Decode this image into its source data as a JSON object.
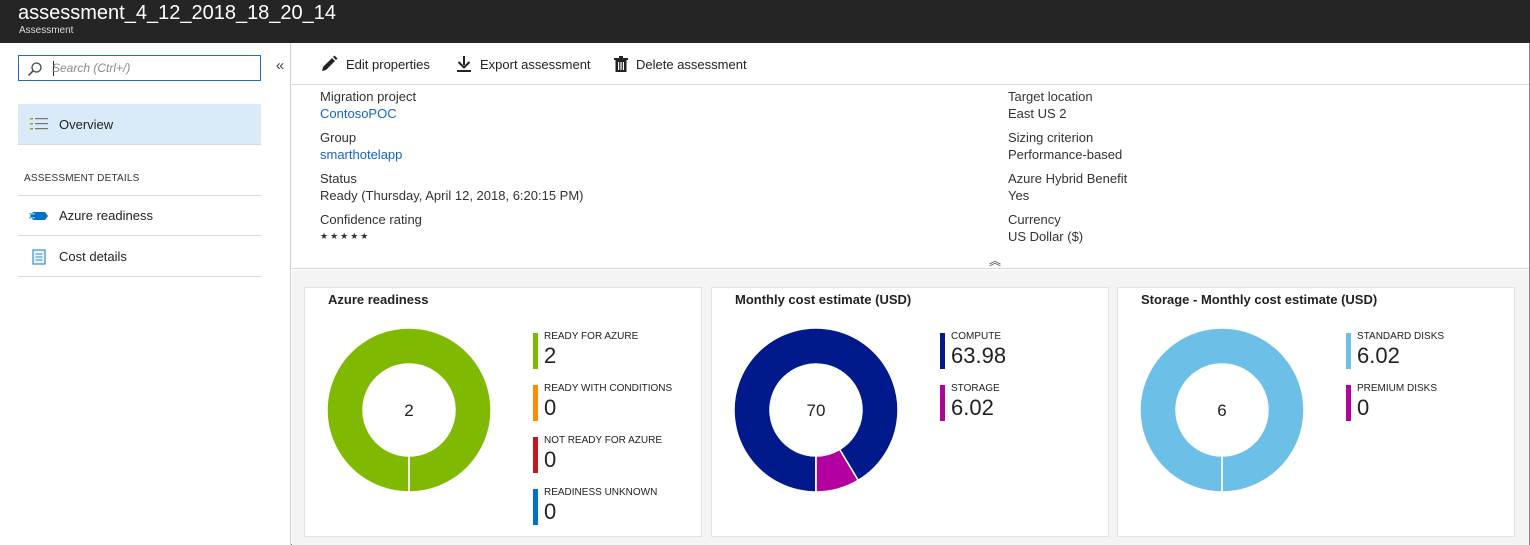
{
  "window": {
    "title": "assessment_4_12_2018_18_20_14",
    "subtitle": "Assessment"
  },
  "sidebar": {
    "search_placeholder": "Search (Ctrl+/)",
    "collapse_icon": "double-chevron-left-icon",
    "overview_label": "Overview",
    "section_header": "ASSESSMENT DETAILS",
    "items": [
      {
        "label": "Azure readiness",
        "icon": "readiness-icon"
      },
      {
        "label": "Cost details",
        "icon": "document-icon"
      }
    ]
  },
  "toolbar": {
    "edit_label": "Edit properties",
    "export_label": "Export assessment",
    "delete_label": "Delete assessment"
  },
  "details": {
    "left": [
      {
        "label": "Migration project",
        "value": "ContosoPOC",
        "link": true
      },
      {
        "label": "Group",
        "value": "smarthotelapp",
        "link": true
      },
      {
        "label": "Status",
        "value": "Ready (Thursday, April 12, 2018, 6:20:15 PM)",
        "link": false
      },
      {
        "label": "Confidence rating",
        "value": "★★★★★",
        "link": false
      }
    ],
    "right": [
      {
        "label": "Target location",
        "value": "East US 2"
      },
      {
        "label": "Sizing criterion",
        "value": "Performance-based"
      },
      {
        "label": "Azure Hybrid Benefit",
        "value": "Yes"
      },
      {
        "label": "Currency",
        "value": "US Dollar ($)"
      }
    ]
  },
  "colors": {
    "ready": "#7fba00",
    "conditions": "#ff8c00",
    "not_ready": "#c4161c",
    "unknown": "#0072c6",
    "compute": "#001a8c",
    "storage": "#b4009e",
    "standard_disks": "#6cc0e8",
    "premium_disks": "#b4009e"
  },
  "chart_data": [
    {
      "type": "pie",
      "title": "Azure readiness",
      "center_label": "2",
      "series": [
        {
          "name": "READY FOR AZURE",
          "value": 2,
          "display": "2",
          "color": "#7fba00"
        },
        {
          "name": "READY WITH CONDITIONS",
          "value": 0,
          "display": "0",
          "color": "#ff8c00"
        },
        {
          "name": "NOT READY FOR AZURE",
          "value": 0,
          "display": "0",
          "color": "#c4161c"
        },
        {
          "name": "READINESS UNKNOWN",
          "value": 0,
          "display": "0",
          "color": "#0072c6"
        }
      ]
    },
    {
      "type": "pie",
      "title": "Monthly cost estimate (USD)",
      "center_label": "70",
      "series": [
        {
          "name": "COMPUTE",
          "value": 63.98,
          "display": "63.98",
          "color": "#001a8c"
        },
        {
          "name": "STORAGE",
          "value": 6.02,
          "display": "6.02",
          "color": "#b4009e"
        }
      ]
    },
    {
      "type": "pie",
      "title": "Storage - Monthly cost estimate (USD)",
      "center_label": "6",
      "series": [
        {
          "name": "STANDARD DISKS",
          "value": 6.02,
          "display": "6.02",
          "color": "#6cc0e8"
        },
        {
          "name": "PREMIUM DISKS",
          "value": 0,
          "display": "0",
          "color": "#b4009e"
        }
      ]
    }
  ]
}
